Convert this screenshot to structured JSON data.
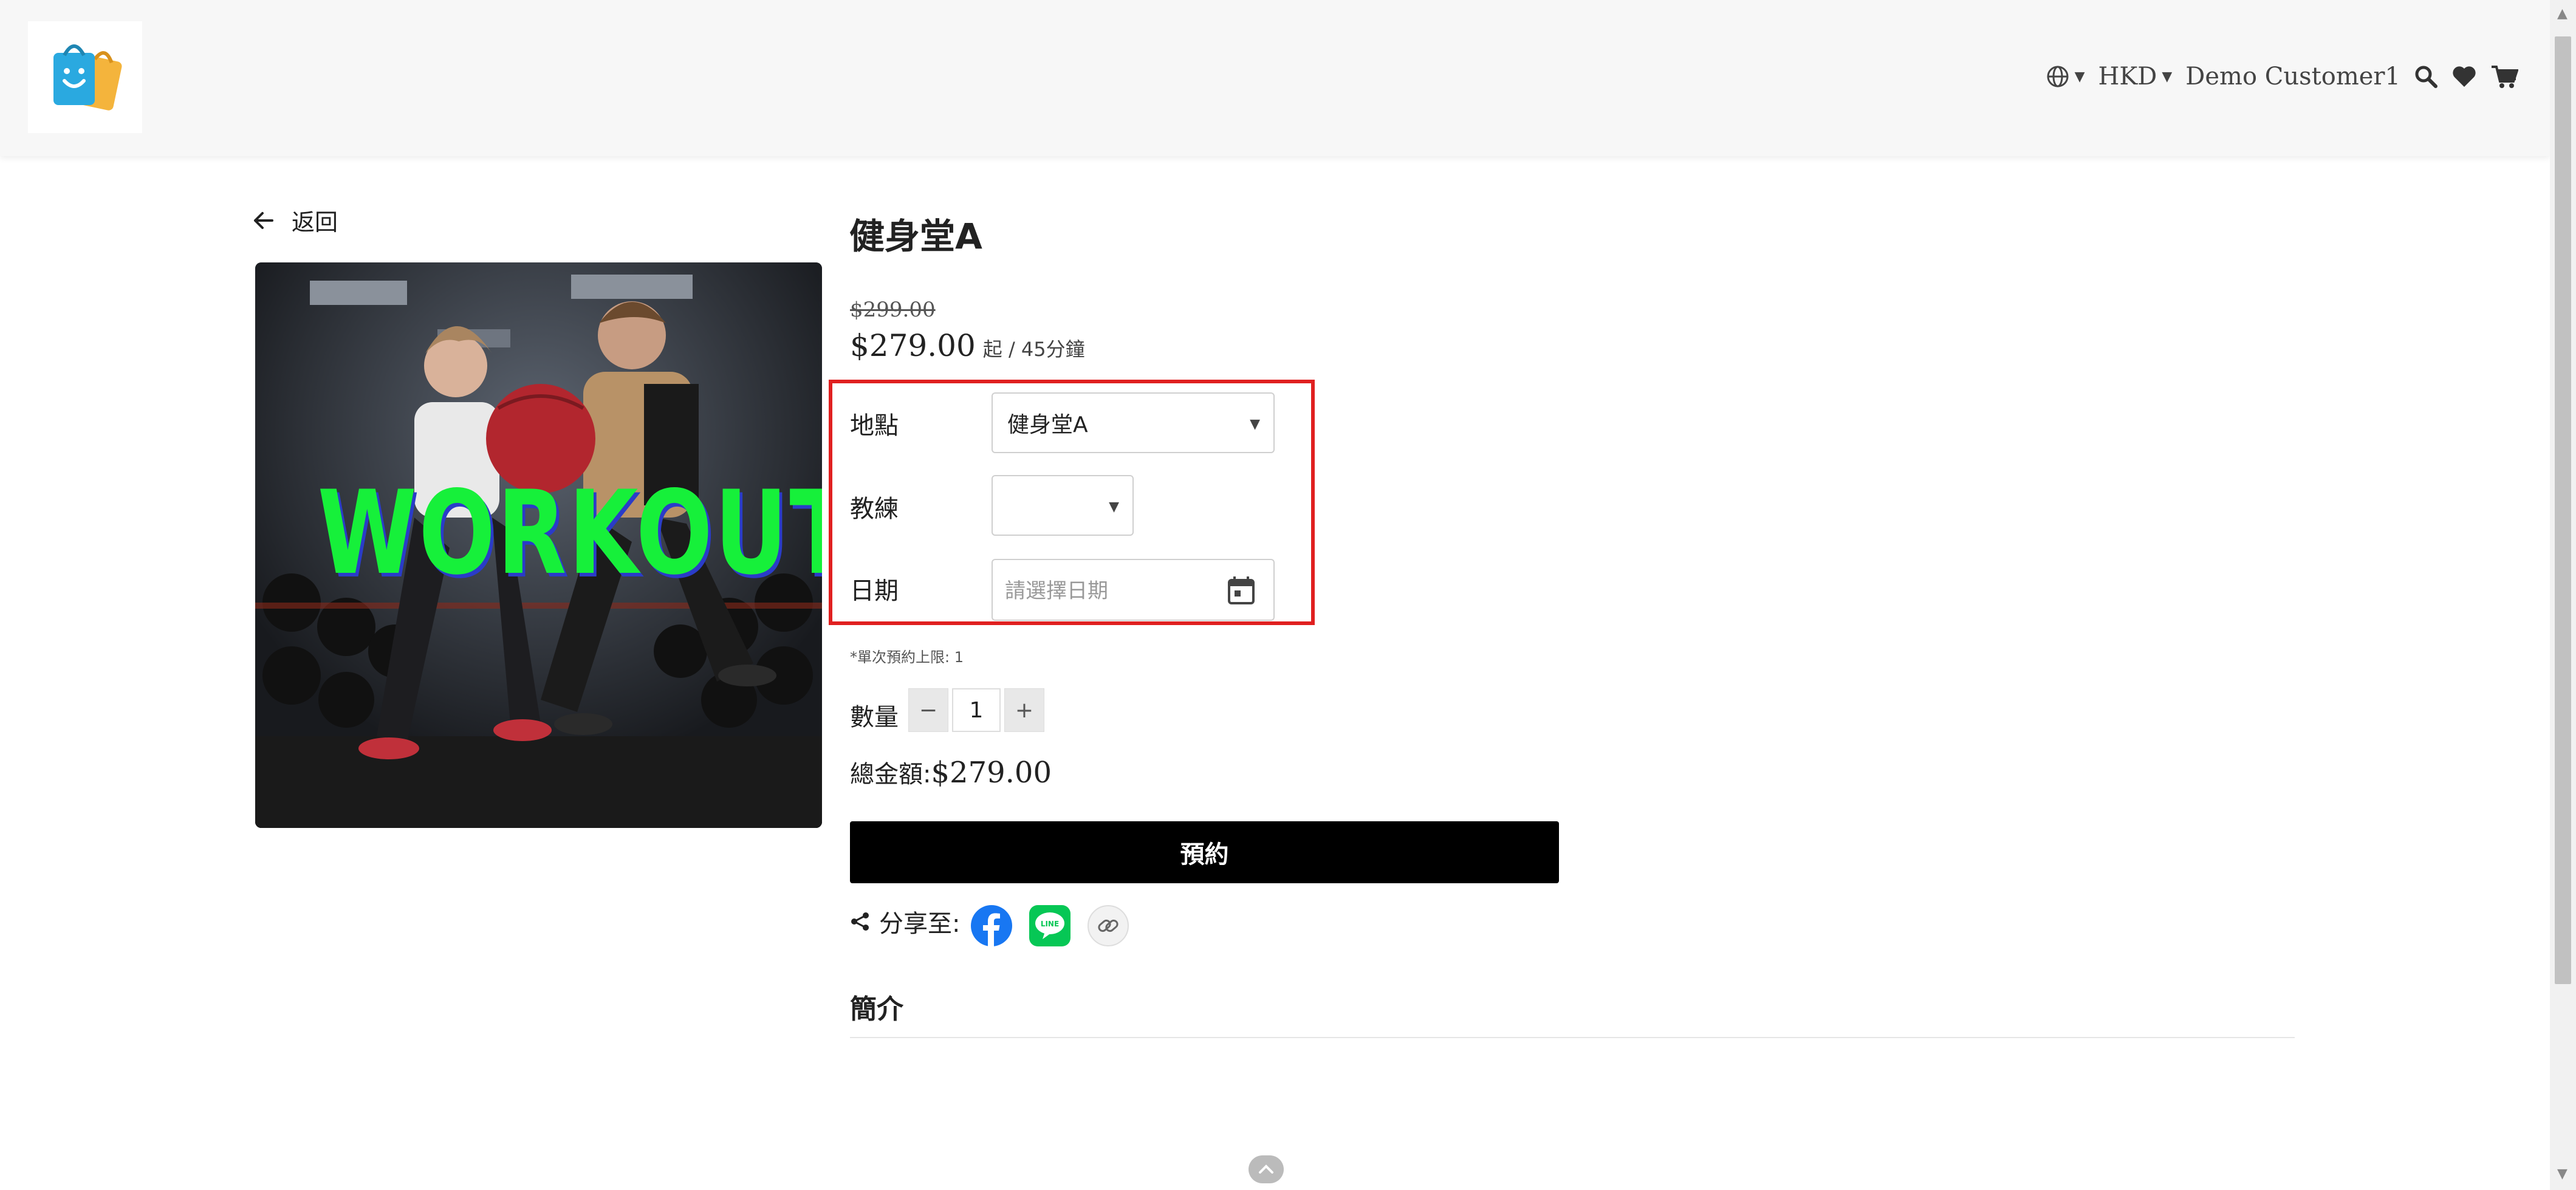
{
  "header": {
    "currency": "HKD",
    "user_name": "Demo Customer1",
    "icons": [
      "globe-icon",
      "search-icon",
      "heart-icon",
      "cart-icon"
    ]
  },
  "back": {
    "label": "返回"
  },
  "product": {
    "title": "健身堂A",
    "image_text": "WORKOUT",
    "old_price": "$299.00",
    "price": "$279.00",
    "price_suffix": "起 / 45分鐘"
  },
  "options": {
    "location_label": "地點",
    "location_value": "健身堂A",
    "coach_label": "教練",
    "coach_value": "",
    "date_label": "日期",
    "date_placeholder": "請選擇日期"
  },
  "booking_note": "*單次預約上限: 1",
  "quantity": {
    "label": "數量",
    "value": "1",
    "minus": "−",
    "plus": "+"
  },
  "total": {
    "label": "總金額:",
    "amount": "$279.00"
  },
  "book_button": "預約",
  "share": {
    "label": "分享至:",
    "networks": [
      "facebook",
      "line",
      "copy-link"
    ]
  },
  "intro_heading": "簡介",
  "colors": {
    "accent_black": "#000000",
    "highlight_red": "#e02020",
    "facebook_blue": "#1877f2",
    "line_green": "#06c755",
    "workout_green": "#16f03a"
  }
}
